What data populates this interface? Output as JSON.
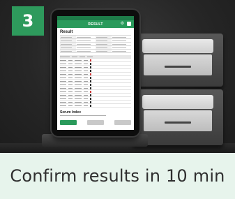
{
  "step": {
    "number": "3",
    "color": "#2e9a5c"
  },
  "caption": {
    "text": "Confirm results in 10 min",
    "background": "#e7f4ec"
  },
  "device_screen": {
    "header_title": "RESULT",
    "page_title": "Result",
    "serum_title": "Serum Index",
    "accent_color": "#2a9a5b"
  }
}
